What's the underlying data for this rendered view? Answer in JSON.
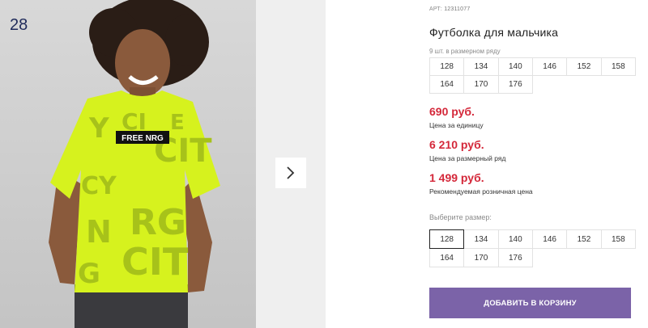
{
  "gallery": {
    "page_number": "28",
    "shirt_print_text": "FREE NRG",
    "next_icon": "chevron-right-icon"
  },
  "product": {
    "article_label": "АРТ:",
    "article_number": "12311077",
    "title": "Футболка для мальчика",
    "pack_label": "9 шт. в размерном ряду",
    "pack_sizes": [
      "128",
      "134",
      "140",
      "146",
      "152",
      "158",
      "164",
      "170",
      "176"
    ]
  },
  "prices": {
    "unit_price": "690 руб.",
    "unit_caption": "Цена за единицу",
    "pack_price": "6 210 руб.",
    "pack_caption": "Цена за размерный ряд",
    "retail_price": "1 499 руб.",
    "retail_caption": "Рекомендуемая розничная цена"
  },
  "size_select": {
    "label": "Выберите размер:",
    "options": [
      "128",
      "134",
      "140",
      "146",
      "152",
      "158",
      "164",
      "170",
      "176"
    ],
    "selected": "128"
  },
  "cart": {
    "add_label": "ДОБАВИТЬ В КОРЗИНУ"
  },
  "colors": {
    "price_red": "#d4283a",
    "button_purple": "#7b63a8",
    "shirt_neon": "#d6f21e"
  }
}
